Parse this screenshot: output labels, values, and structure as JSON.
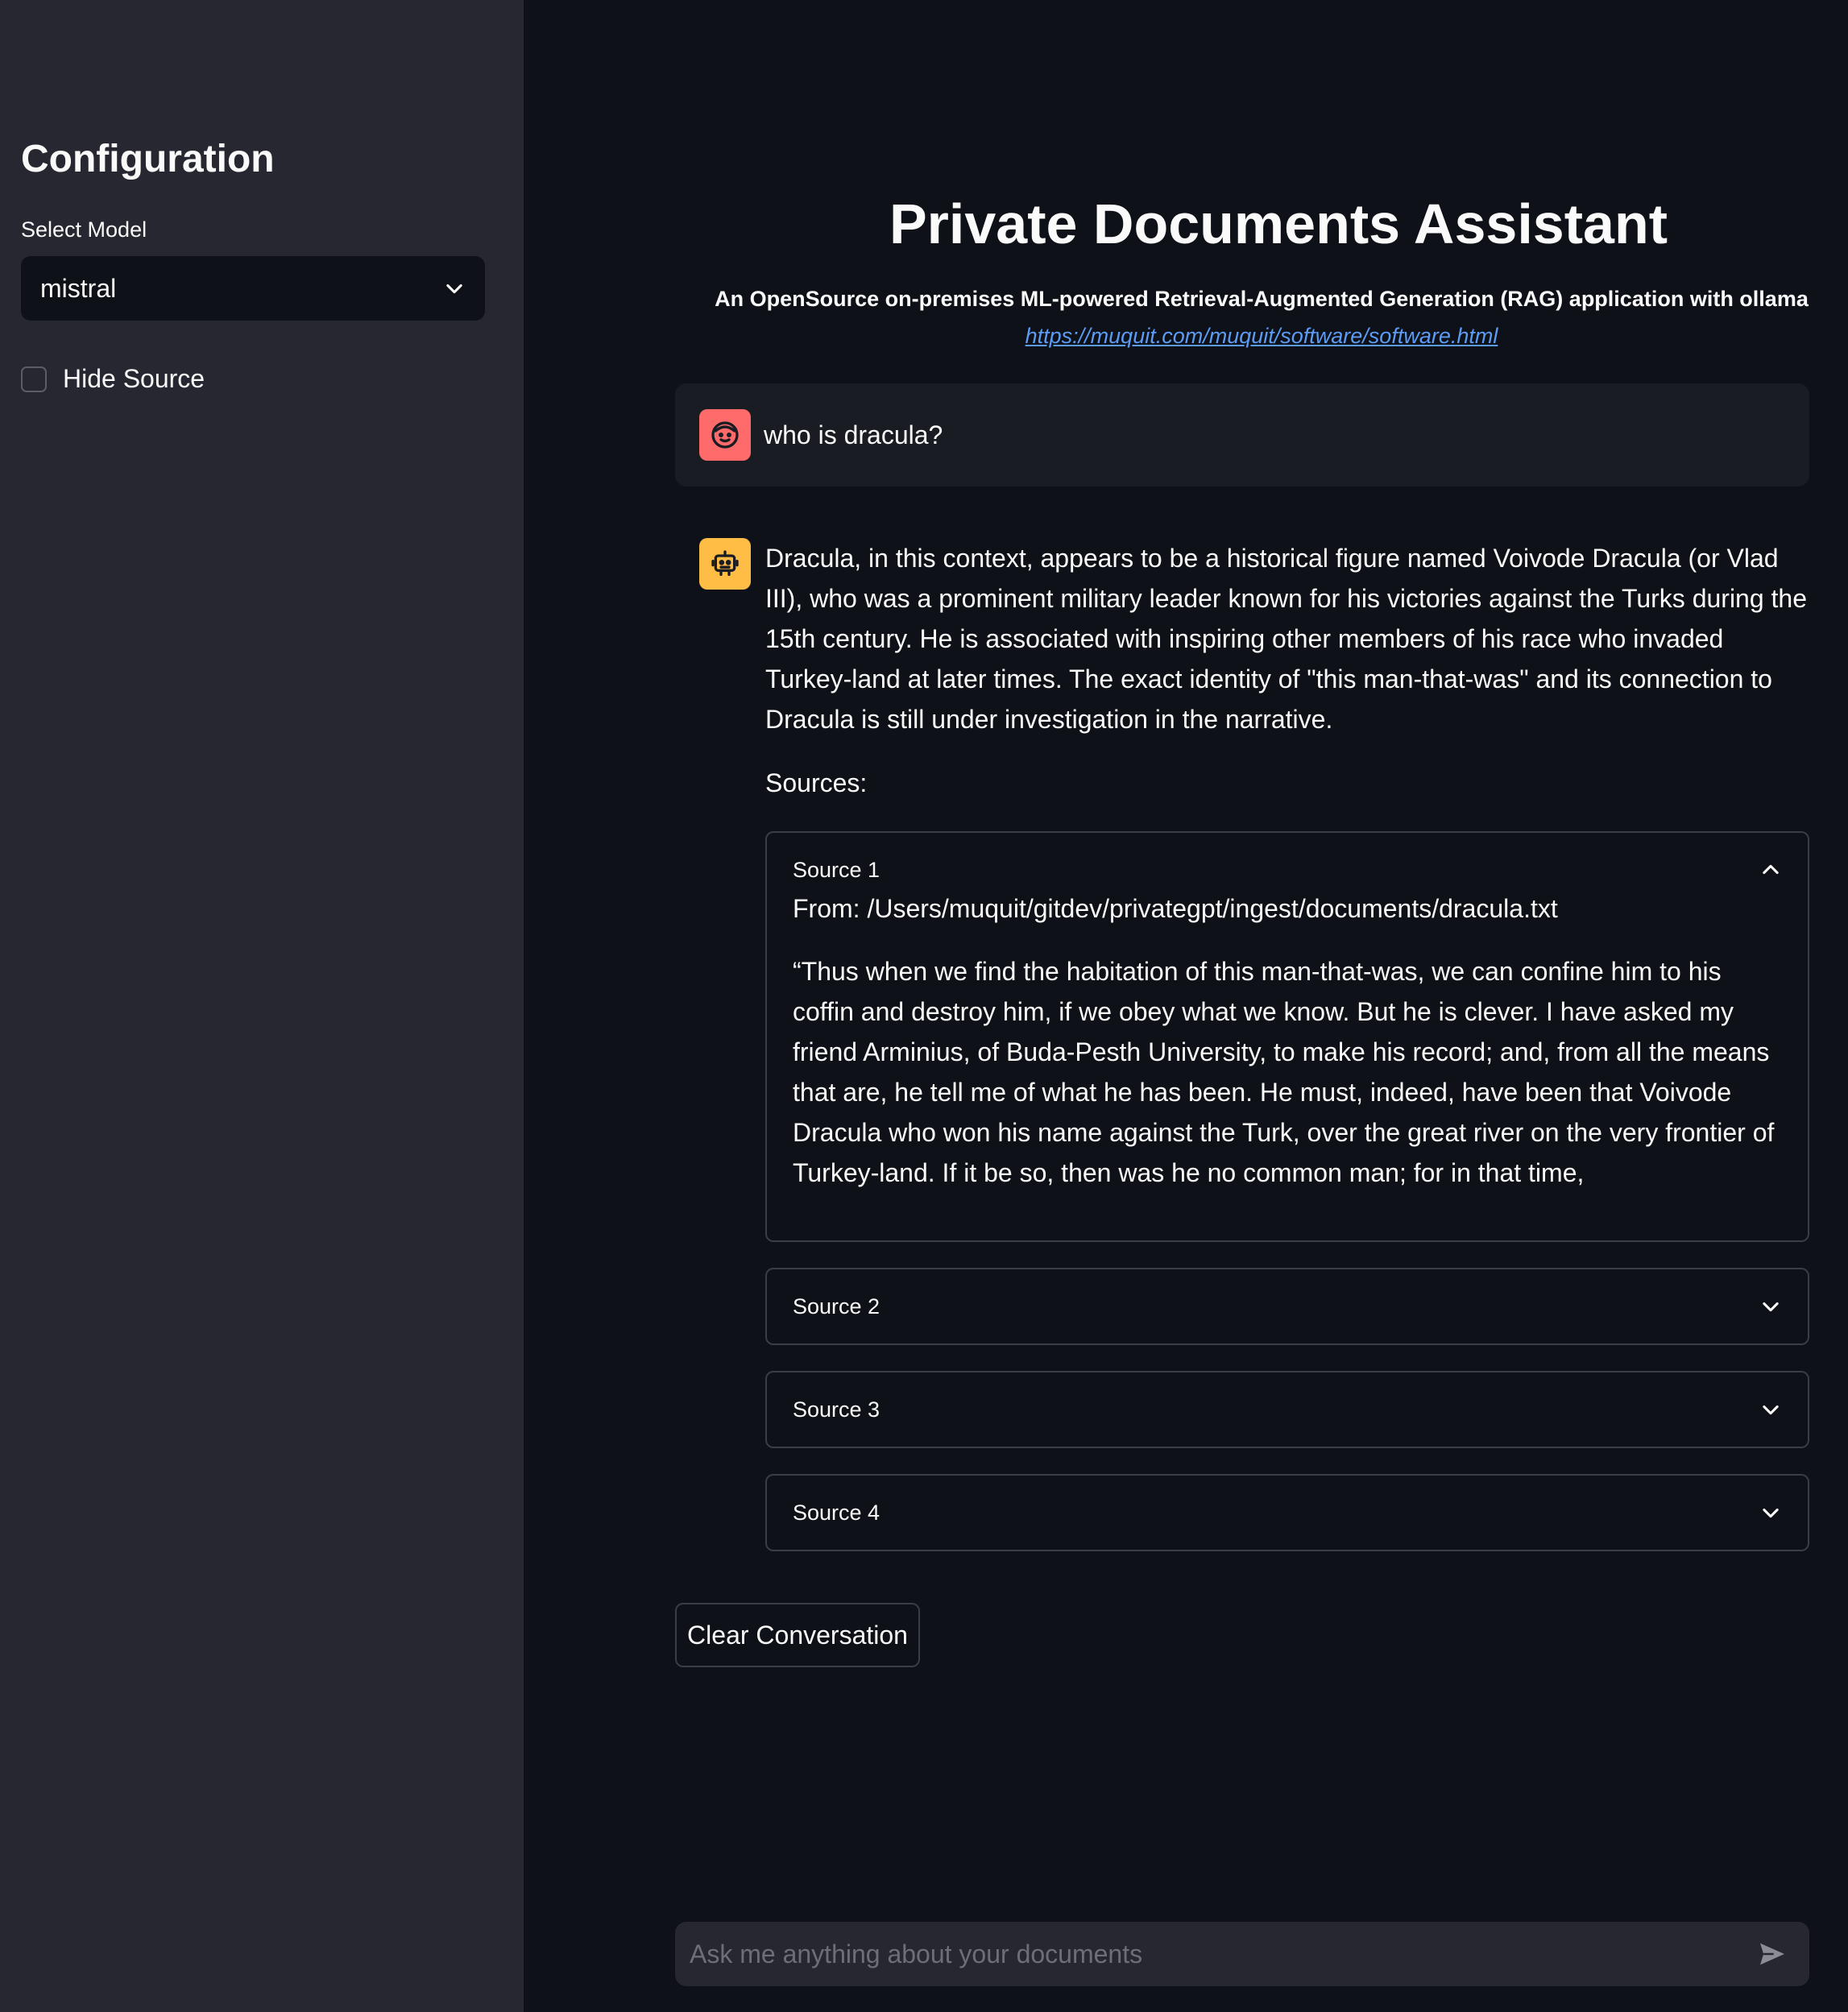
{
  "sidebar": {
    "title": "Configuration",
    "model_label": "Select Model",
    "model_value": "mistral",
    "hide_source_label": "Hide Source",
    "hide_source_checked": false
  },
  "header": {
    "title": "Private Documents Assistant",
    "subtitle": "An OpenSource on-premises ML-powered Retrieval-Augmented Generation (RAG) application with ollama",
    "link": "https://muquit.com/muquit/software/software.html"
  },
  "chat": {
    "user_message": "who is dracula?",
    "assistant_message": "Dracula, in this context, appears to be a historical figure named Voivode Dracula (or Vlad III), who was a prominent military leader known for his victories against the Turks during the 15th century. He is associated with inspiring other members of his race who invaded Turkey-land at later times. The exact identity of \"this man-that-was\" and its connection to Dracula is still under investigation in the narrative.",
    "sources_label": "Sources:",
    "sources": [
      {
        "title": "Source 1",
        "expanded": true,
        "from": "From: /Users/muquit/gitdev/privategpt/ingest/documents/dracula.txt",
        "content": "“Thus when we find the habitation of this man-that-was, we can confine him to his coffin and destroy him, if we obey what we know. But he is clever. I have asked my friend Arminius, of Buda-Pesth University, to make his record; and, from all the means that are, he tell me of what he has been. He must, indeed, have been that Voivode Dracula who won his name against the Turk, over the great river on the very frontier of Turkey-land. If it be so, then was he no common man; for in that time,"
      },
      {
        "title": "Source 2",
        "expanded": false
      },
      {
        "title": "Source 3",
        "expanded": false
      },
      {
        "title": "Source 4",
        "expanded": false
      }
    ]
  },
  "actions": {
    "clear_label": "Clear Conversation"
  },
  "input": {
    "placeholder": "Ask me anything about your documents"
  },
  "colors": {
    "background": "#0e1117",
    "sidebar": "#262730",
    "user_avatar": "#ff6b6b",
    "bot_avatar": "#ffbd45",
    "link": "#5c9cf5"
  }
}
